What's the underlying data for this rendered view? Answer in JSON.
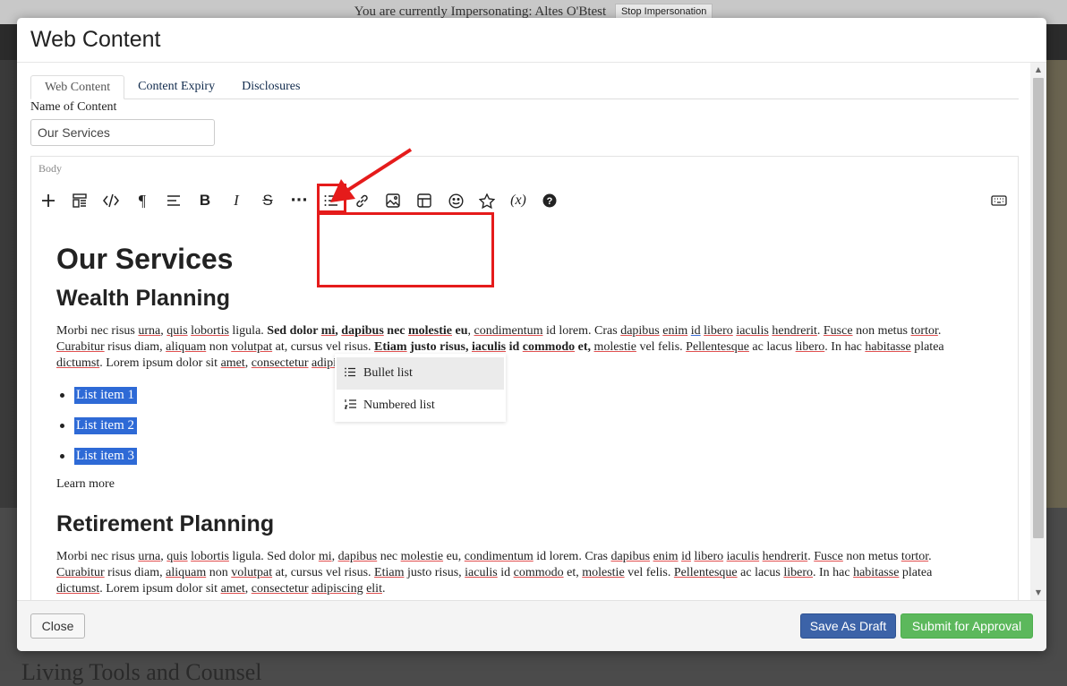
{
  "background": {
    "banner_text": "You are currently Impersonating: Altes O'Btest",
    "stop_button": "Stop Impersonation",
    "footer_text": "Living Tools and Counsel"
  },
  "modal": {
    "title": "Web Content",
    "tabs": [
      "Web Content",
      "Content Expiry",
      "Disclosures"
    ],
    "active_tab": "Web Content",
    "name_label": "Name of Content",
    "name_value": "Our Services",
    "body_label": "Body"
  },
  "toolbar": {
    "icons": [
      "plus-icon",
      "block-icon",
      "code-icon",
      "paragraph-icon",
      "align-icon",
      "bold-icon",
      "italic-icon",
      "strikethrough-icon",
      "more-icon",
      "list-icon",
      "link-icon",
      "image-icon",
      "table-icon",
      "emoji-icon",
      "star-icon",
      "variable-icon",
      "help-icon",
      "keyboard-icon"
    ]
  },
  "dropdown": {
    "items": [
      {
        "label": "Bullet list",
        "icon": "bullet-list-icon"
      },
      {
        "label": "Numbered list",
        "icon": "numbered-list-icon"
      }
    ]
  },
  "content": {
    "heading": "Our Services",
    "section1_title": "Wealth Planning",
    "list_items": [
      "List item 1",
      "List item 2",
      "List item 3"
    ],
    "learn_more": "Learn more",
    "section2_title": "Retirement Planning"
  },
  "footer": {
    "close": "Close",
    "save_draft": "Save As Draft",
    "submit": "Submit for Approval"
  },
  "colors": {
    "highlight": "#e51b1b",
    "selection": "#2e6ad6",
    "draft_button": "#3c63a8",
    "submit_button": "#5cb85c"
  }
}
